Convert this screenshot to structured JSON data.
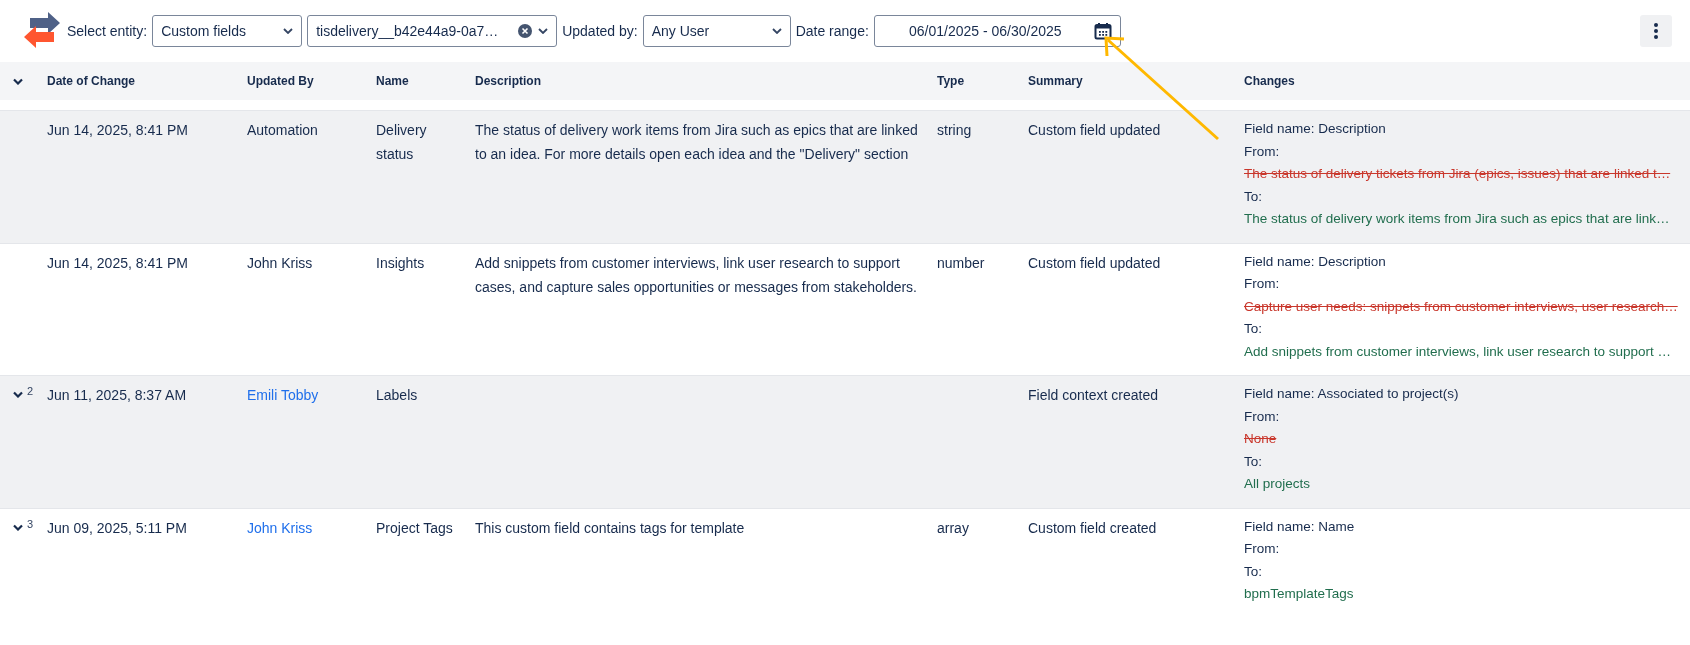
{
  "toolbar": {
    "entity_label": "Select entity:",
    "entity": "Custom fields",
    "field": "tisdelivery__b42e44a9-0a7…",
    "updated_by_label": "Updated by:",
    "updated_by": "Any User",
    "date_label": "Date range:",
    "date_range": "06/01/2025 - 06/30/2025"
  },
  "table": {
    "columns": [
      "Date of Change",
      "Updated By",
      "Name",
      "Description",
      "Type",
      "Summary",
      "Changes"
    ],
    "rows": [
      {
        "expandable": false,
        "shaded": true,
        "date": "Jun 14, 2025, 8:41 PM",
        "updated_by": "Automation",
        "link": false,
        "name": "Delivery status",
        "description": "The status of delivery work items from Jira such as epics that are linked to an idea. For more details open each idea and the \"Delivery\" section",
        "type": "string",
        "summary": "Custom field updated",
        "changes": [
          {
            "kind": "label",
            "text": "Field name: Description"
          },
          {
            "kind": "label",
            "text": "From:"
          },
          {
            "kind": "removed",
            "text": "The status of delivery tickets from Jira (epics, issues) that are linked t…"
          },
          {
            "kind": "label",
            "text": "To:"
          },
          {
            "kind": "added",
            "text": "The status of delivery work items from Jira such as epics that are link…"
          }
        ]
      },
      {
        "expandable": false,
        "shaded": false,
        "date": "Jun 14, 2025, 8:41 PM",
        "updated_by": "John Kriss",
        "link": false,
        "name": "Insights",
        "description": "Add snippets from customer interviews, link user research to support cases, and capture sales opportunities or messages from stakeholders.",
        "type": "number",
        "summary": "Custom field updated",
        "changes": [
          {
            "kind": "label",
            "text": "Field name: Description"
          },
          {
            "kind": "label",
            "text": "From:"
          },
          {
            "kind": "removed",
            "text": "Capture user needs: snippets from customer interviews, user research…"
          },
          {
            "kind": "label",
            "text": "To:"
          },
          {
            "kind": "added",
            "text": "Add snippets from customer interviews, link user research to support …"
          }
        ]
      },
      {
        "expandable": true,
        "count": "2",
        "shaded": true,
        "date": "Jun 11, 2025, 8:37 AM",
        "updated_by": "Emili Tobby",
        "link": true,
        "name": "Labels",
        "summary": "Field context created",
        "changes": [
          {
            "kind": "label",
            "text": "Field name: Associated to project(s)"
          },
          {
            "kind": "label",
            "text": "From:"
          },
          {
            "kind": "removed",
            "text": "None"
          },
          {
            "kind": "label",
            "text": "To:"
          },
          {
            "kind": "added",
            "text": "All projects"
          }
        ]
      },
      {
        "expandable": true,
        "count": "3",
        "shaded": false,
        "date": "Jun 09, 2025, 5:11 PM",
        "updated_by": "John Kriss",
        "link": true,
        "name": "Project Tags",
        "description": "This custom field contains tags for template",
        "type": "array",
        "summary": "Custom field created",
        "changes": [
          {
            "kind": "label",
            "text": "Field name: Name"
          },
          {
            "kind": "label",
            "text": "From:"
          },
          {
            "kind": "label",
            "text": "To:"
          },
          {
            "kind": "added",
            "text": "bpmTemplateTags"
          }
        ]
      }
    ]
  }
}
